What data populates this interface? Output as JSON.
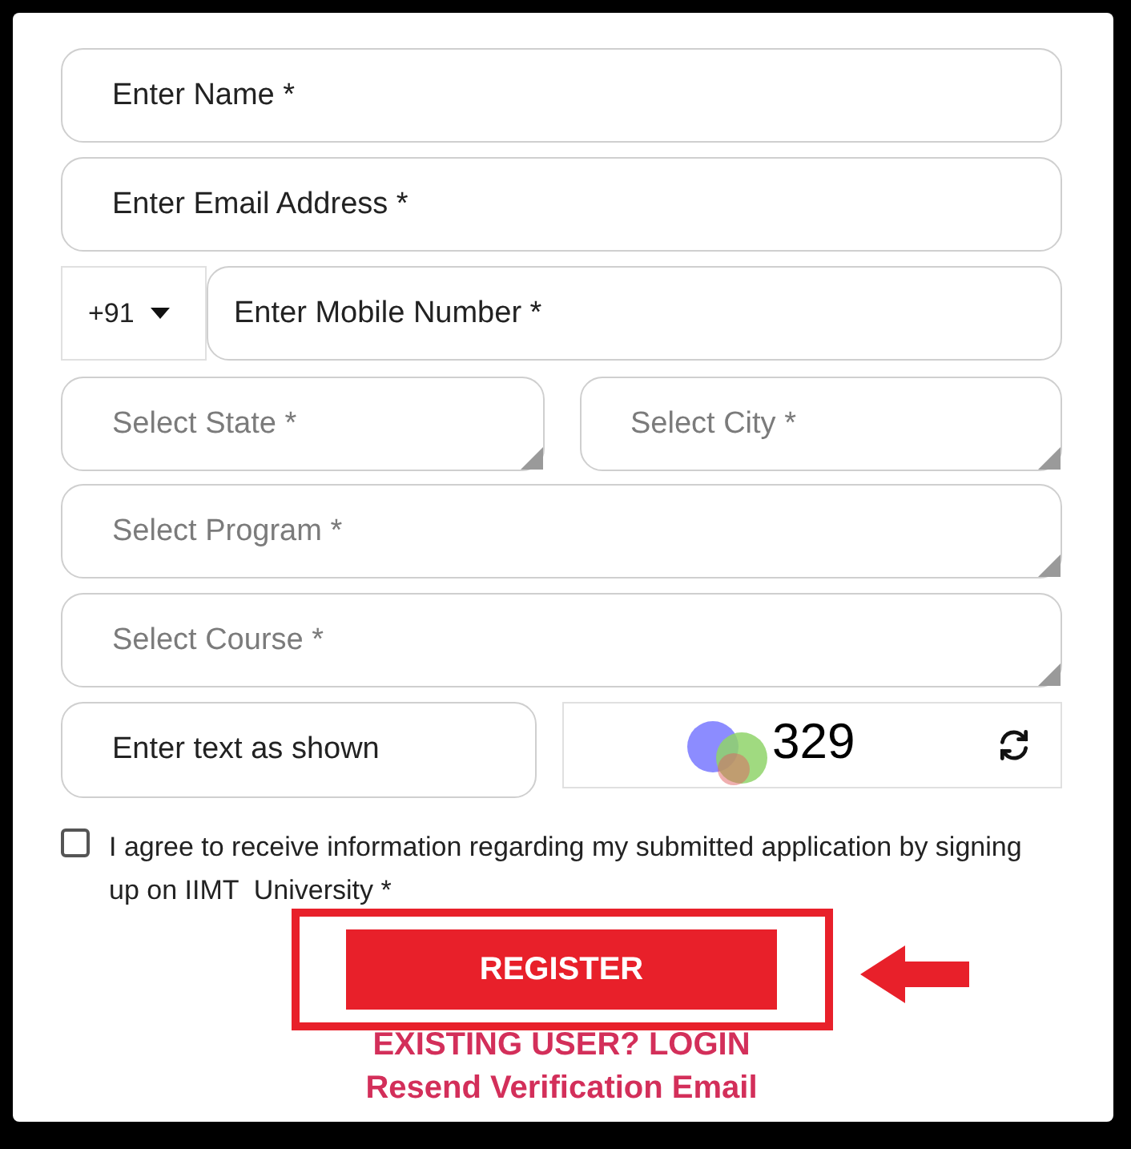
{
  "fields": [
    {
      "kind": "input",
      "placeholder": "Enter Name *"
    },
    {
      "kind": "input",
      "placeholder": "Enter Email Address *"
    }
  ],
  "mobile": {
    "country_code": "+91",
    "placeholder": "Enter Mobile Number *"
  },
  "location": [
    {
      "kind": "select",
      "placeholder": "Select State *"
    },
    {
      "kind": "select",
      "placeholder": "Select City *"
    }
  ],
  "selects": [
    {
      "kind": "select",
      "placeholder": "Select Program *"
    },
    {
      "kind": "select",
      "placeholder": "Select Course *"
    }
  ],
  "captcha": {
    "placeholder": "Enter text as shown",
    "code": "329"
  },
  "consent": {
    "checked": false,
    "text": "I agree to receive information regarding my submitted application by signing up on IIMT  University *"
  },
  "register_button": "REGISTER",
  "links": [
    "EXISTING USER? LOGIN",
    "Resend Verification Email"
  ]
}
